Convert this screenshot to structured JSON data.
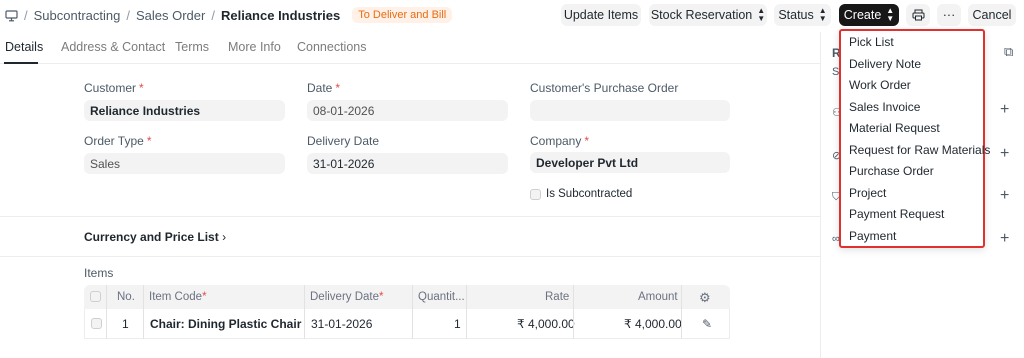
{
  "breadcrumb": {
    "items": [
      "Subcontracting",
      "Sales Order"
    ],
    "separator": "/",
    "title": "Reliance Industries",
    "status": "To Deliver and Bill"
  },
  "toolbar": {
    "update_items": "Update Items",
    "stock_reservation": "Stock Reservation",
    "status": "Status",
    "create": "Create",
    "more": "···",
    "cancel": "Cancel"
  },
  "tabs": [
    "Details",
    "Address & Contact",
    "Terms",
    "More Info",
    "Connections"
  ],
  "form": {
    "customer_label": "Customer",
    "customer_value": "Reliance Industries",
    "date_label": "Date",
    "date_value": "08-01-2026",
    "po_label": "Customer's Purchase Order",
    "order_type_label": "Order Type",
    "order_type_value": "Sales",
    "delivery_date_label": "Delivery Date",
    "delivery_date_value": "31-01-2026",
    "company_label": "Company",
    "company_value": "Developer Pvt Ltd",
    "subcontracted_label": "Is Subcontracted",
    "required_mark": "*"
  },
  "sections": {
    "currency": "Currency and Price List",
    "items": "Items"
  },
  "items_table": {
    "columns": [
      "No.",
      "Item Code",
      "Delivery Date",
      "Quantit...",
      "Rate",
      "Amount"
    ],
    "rows": [
      {
        "no": "1",
        "item_code": "Chair: Dining Plastic Chair",
        "delivery_date": "31-01-2026",
        "qty": "1",
        "rate": "₹ 4,000.00",
        "amount": "₹ 4,000.00"
      }
    ]
  },
  "create_menu": [
    "Pick List",
    "Delivery Note",
    "Work Order",
    "Sales Invoice",
    "Material Request",
    "Request for Raw Materials",
    "Purchase Order",
    "Project",
    "Payment Request",
    "Payment"
  ],
  "sidebar": {
    "plus": "+",
    "partial_r": "R",
    "partial_s": "S"
  }
}
